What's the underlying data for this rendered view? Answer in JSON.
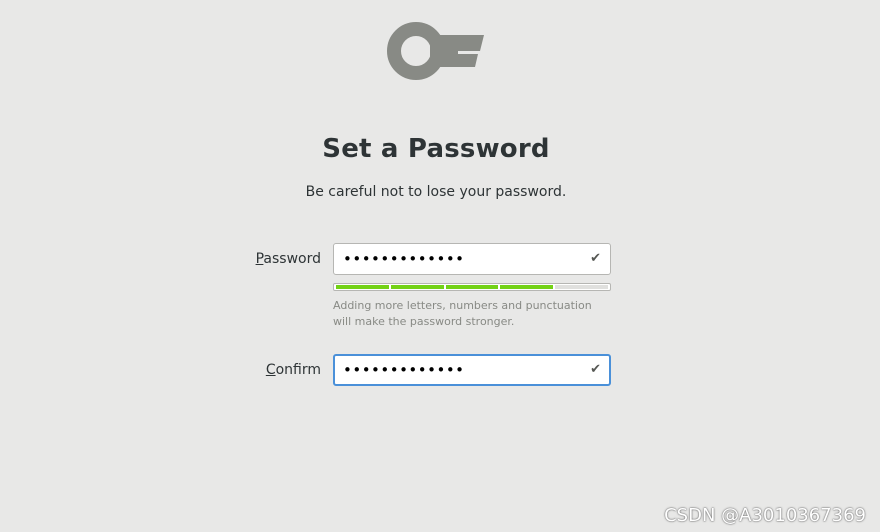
{
  "logo": {
    "icon": "key-icon",
    "color": "#888a85"
  },
  "header": {
    "title": "Set a Password",
    "subtitle": "Be careful not to lose your password."
  },
  "form": {
    "password": {
      "label_mnemonic": "P",
      "label_rest": "assword",
      "masked_value": "•••••••••••••",
      "status_icon": "checkmark-icon",
      "status_glyph": "✔"
    },
    "strength": {
      "level": 0.8,
      "filled_segments": 4,
      "total_segments": 5,
      "fill_color": "#73d216"
    },
    "hint": "Adding more letters, numbers and punctuation will make the password stronger.",
    "confirm": {
      "label_mnemonic": "C",
      "label_rest": "onfirm",
      "masked_value": "•••••••••••••",
      "status_icon": "checkmark-icon",
      "status_glyph": "✔"
    }
  },
  "watermark": "CSDN @A3010367369",
  "colors": {
    "background": "#e8e8e7",
    "focus": "#4a90d9"
  }
}
